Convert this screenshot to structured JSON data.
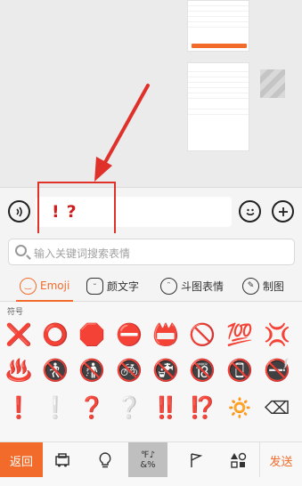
{
  "composer": {
    "typed_text": "!?",
    "voice_icon": "voice-icon",
    "emoji_icon": "smiley-icon",
    "plus_icon": "plus-icon"
  },
  "search": {
    "placeholder": "输入关键词搜索表情"
  },
  "tabs": [
    {
      "label": "Emoji",
      "icon": "smiley-icon"
    },
    {
      "label": "颜文字",
      "icon": "kaomoji-icon"
    },
    {
      "label": "斗图表情",
      "icon": "meme-icon"
    },
    {
      "label": "制图",
      "icon": "draw-icon"
    }
  ],
  "emoji_panel": {
    "category": "符号",
    "rows": [
      [
        "❌",
        "⭕",
        "🛑",
        "⛔",
        "📛",
        "🚫",
        "💯",
        "💢"
      ],
      [
        "♨️",
        "🚷",
        "🚯",
        "🚳",
        "🚱",
        "🔞",
        "📵",
        "🚭"
      ],
      [
        "❗",
        "❕",
        "❓",
        "❔",
        "‼️",
        "⁉️",
        "🔅",
        "⌫"
      ]
    ],
    "page_count": 12,
    "active_page": 4
  },
  "bottom_bar": {
    "back_label": "返回",
    "symbols_label": "℉♪ &%",
    "send_label": "发送"
  },
  "colors": {
    "accent": "#f26b2a",
    "annotation": "#e0302a"
  }
}
